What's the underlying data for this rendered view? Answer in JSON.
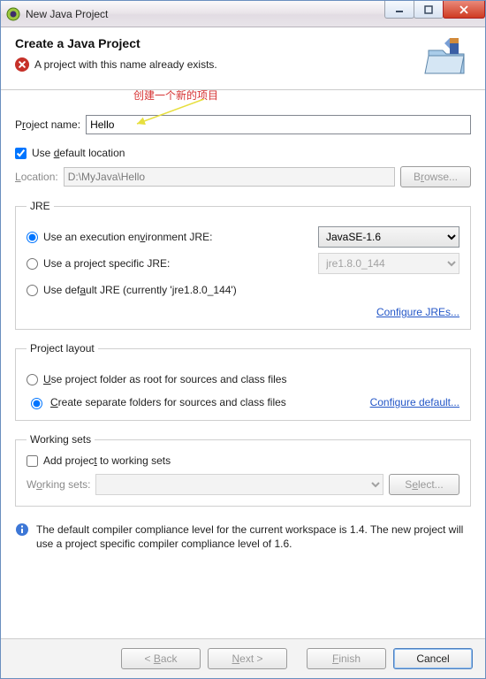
{
  "titlebar": {
    "title": "New Java Project"
  },
  "header": {
    "title": "Create a Java Project",
    "message": "A project with this name already exists."
  },
  "annotation": "创建一个新的项目",
  "project_name": {
    "label_pre": "P",
    "label_u": "r",
    "label_post": "oject name:",
    "value": "Hello"
  },
  "use_default_location": {
    "label_pre": "Use ",
    "label_u": "d",
    "label_post": "efault location",
    "checked": true
  },
  "location": {
    "label_pre": "",
    "label_u": "L",
    "label_post": "ocation:",
    "value": "D:\\MyJava\\Hello",
    "browse_pre": "B",
    "browse_u": "r",
    "browse_post": "owse..."
  },
  "jre": {
    "legend": "JRE",
    "env": {
      "label_pre": "Use an execution en",
      "label_u": "v",
      "label_post": "ironment JRE:",
      "value": "JavaSE-1.6"
    },
    "specific": {
      "label_pre": "Use a project specific JRE:",
      "value": "jre1.8.0_144"
    },
    "default": {
      "label_pre": "Use def",
      "label_u": "a",
      "label_post": "ult JRE (currently 'jre1.8.0_144')"
    },
    "configure": "Configure JREs...",
    "selected": "env"
  },
  "layout": {
    "legend": "Project layout",
    "root": {
      "label_u": "U",
      "label_post": "se project folder as root for sources and class files"
    },
    "separate": {
      "label_u": "C",
      "label_post": "reate separate folders for sources and class files"
    },
    "configure": "Configure default...",
    "selected": "separate"
  },
  "working_sets": {
    "legend": "Working sets",
    "add": {
      "label_pre": "Add projec",
      "label_u": "t",
      "label_post": " to working sets",
      "checked": false
    },
    "label": {
      "label_pre": "W",
      "label_u": "o",
      "label_post": "rking sets:"
    },
    "value": "",
    "select_btn": {
      "pre": "S",
      "u": "e",
      "post": "lect..."
    }
  },
  "info": "The default compiler compliance level for the current workspace is 1.4. The new project will use a project specific compiler compliance level of 1.6.",
  "footer": {
    "back": {
      "lt": "< ",
      "u": "B",
      "post": "ack"
    },
    "next": {
      "u": "N",
      "post": "ext >"
    },
    "finish": {
      "u": "F",
      "post": "inish"
    },
    "cancel": "Cancel"
  }
}
